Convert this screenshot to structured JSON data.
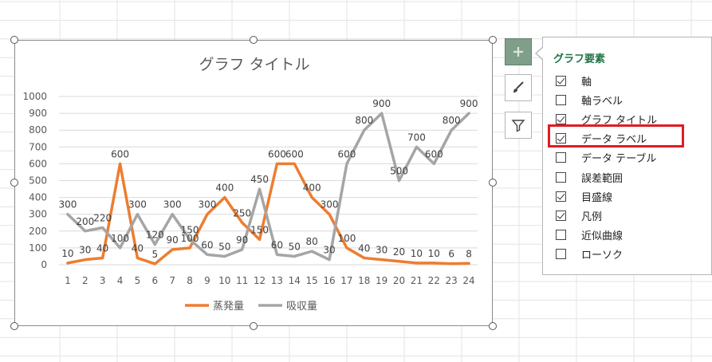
{
  "chart_panel": {
    "title": "グラフ要素",
    "items": [
      {
        "label": "軸",
        "checked": true
      },
      {
        "label": "軸ラベル",
        "checked": false
      },
      {
        "label": "グラフ タイトル",
        "checked": true
      },
      {
        "label": "データ ラベル",
        "checked": true
      },
      {
        "label": "データ テーブル",
        "checked": false
      },
      {
        "label": "誤差範囲",
        "checked": false
      },
      {
        "label": "目盛線",
        "checked": true
      },
      {
        "label": "凡例",
        "checked": true
      },
      {
        "label": "近似曲線",
        "checked": false
      },
      {
        "label": "ローソク",
        "checked": false
      }
    ]
  },
  "side_buttons": {
    "elements": "plus-icon",
    "styles": "brush-icon",
    "filter": "filter-icon"
  },
  "colors": {
    "series1": "#ED7D31",
    "series2": "#A5A5A5",
    "highlight": "#E01B24",
    "panel_title": "#217346"
  },
  "chart_data": {
    "type": "line",
    "title": "グラフ タイトル",
    "categories": [
      "1",
      "2",
      "3",
      "4",
      "5",
      "6",
      "7",
      "8",
      "9",
      "10",
      "11",
      "12",
      "13",
      "14",
      "15",
      "16",
      "17",
      "18",
      "19",
      "20",
      "21",
      "22",
      "23",
      "24"
    ],
    "ylim": [
      0,
      1000
    ],
    "y_ticks": [
      "0",
      "100",
      "200",
      "300",
      "400",
      "500",
      "600",
      "700",
      "800",
      "900",
      "1000"
    ],
    "grid": true,
    "legend": "bottom",
    "series": [
      {
        "name": "蒸発量",
        "color": "#ED7D31",
        "values": [
          10,
          30,
          40,
          600,
          40,
          5,
          90,
          100,
          300,
          400,
          250,
          150,
          600,
          600,
          400,
          300,
          100,
          40,
          30,
          20,
          10,
          10,
          6,
          8
        ]
      },
      {
        "name": "吸収量",
        "color": "#A5A5A5",
        "values": [
          300,
          200,
          220,
          100,
          300,
          120,
          300,
          150,
          60,
          50,
          90,
          450,
          60,
          50,
          80,
          30,
          600,
          800,
          900,
          500,
          700,
          600,
          800,
          900
        ]
      }
    ]
  }
}
